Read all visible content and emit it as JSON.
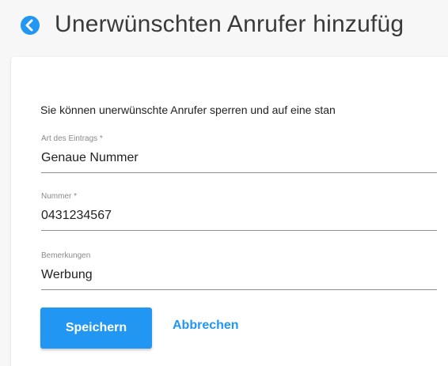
{
  "header": {
    "title": "Unerwünschten Anrufer hinzufüg",
    "back_icon": "chevron-left-circle-icon",
    "accent_color": "#2196f3"
  },
  "form": {
    "intro": "Sie können unerwünschte Anrufer sperren und auf eine stan",
    "fields": [
      {
        "label": "Art des Eintrags *",
        "value": "Genaue Nummer"
      },
      {
        "label": "Nummer *",
        "value": "0431234567"
      },
      {
        "label": "Bemerkungen",
        "value": "Werbung"
      }
    ]
  },
  "actions": {
    "save_label": "Speichern",
    "cancel_label": "Abbrechen"
  }
}
